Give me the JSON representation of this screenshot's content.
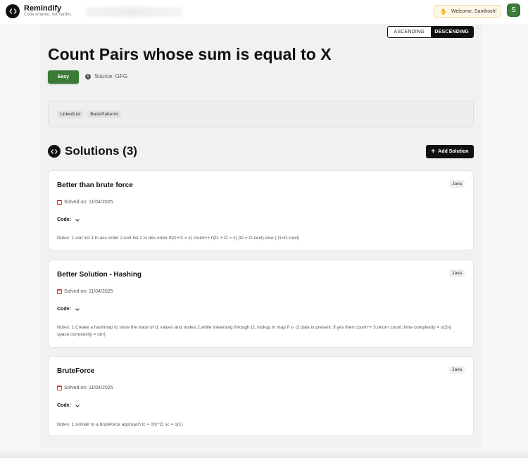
{
  "header": {
    "brand": "Remindify",
    "tagline": "Code smarter, not harder.",
    "welcome": "Welcome, Santhosh!",
    "avatar_letter": "S"
  },
  "sort": {
    "options": [
      "ASCENDING",
      "DESCENDING"
    ],
    "selected": "DESCENDING"
  },
  "problem": {
    "title": "Count Pairs whose sum is equal to X",
    "difficulty": "Easy",
    "difficulty_color": "#3a7a35",
    "source": "Source: GFG",
    "tags": [
      "LinkedList",
      "BasicPatterns"
    ]
  },
  "solutions": {
    "heading": "Solutions (3)",
    "add_label": "Add Solution",
    "items": [
      {
        "title": "Better than brute force",
        "language": "Java",
        "solved": "Solved on: 11/04/2025",
        "code_label": "Code:",
        "notes": "Notes: 1.sort list 1 in asc order 2.sort list 2 in des order if(t1+t2 = x) count++ if(t1 + t2 > x) (t2 = t2.next) else ( t1=t1.next)"
      },
      {
        "title": "Better Solution - Hashing",
        "language": "Java",
        "solved": "Solved on: 11/04/2025",
        "code_label": "Code:",
        "notes": "Notes: 1.Create a hashmap to store the trace of t1 values and nodes 2.while traversing through t2, lookup in map if x- t2.data is present, if yes then count++ 3.return count; time complexity = o(2n) space complexity = o(n)"
      },
      {
        "title": "BruteForce",
        "language": "Java",
        "solved": "Solved on: 11/04/2025",
        "code_label": "Code:",
        "notes": "Notes: 1.similair to a bruteforce approach tc = 0(n^2) sc = o(1)"
      }
    ]
  }
}
